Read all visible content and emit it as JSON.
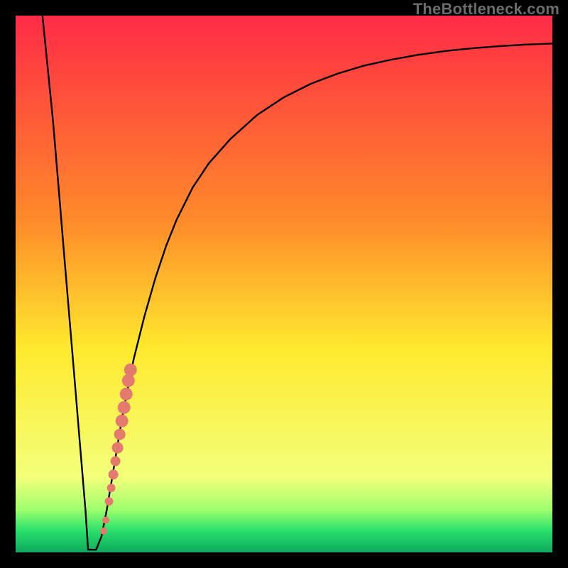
{
  "watermark": "TheBottleneck.com",
  "colors": {
    "frame": "#000000",
    "curve": "#000000",
    "dot": "#e47a6e",
    "grad_top": "#ff2b46",
    "grad_mid1": "#ff8a2a",
    "grad_mid2": "#ffe92e",
    "grad_low": "#f3ff7a",
    "grad_green1": "#9fff6e",
    "grad_green2": "#28e06b",
    "grad_bottom": "#0fa85c"
  },
  "chart_data": {
    "type": "line",
    "title": "",
    "xlabel": "",
    "ylabel": "",
    "xlim": [
      0,
      100
    ],
    "ylim": [
      0,
      100
    ],
    "series": [
      {
        "name": "bottleneck-curve",
        "x": [
          5,
          6,
          7,
          8,
          9,
          10,
          11,
          12,
          13,
          13.5,
          14,
          15,
          16,
          17,
          18,
          19,
          20,
          22,
          24,
          26,
          28,
          30,
          33,
          36,
          40,
          45,
          50,
          55,
          60,
          65,
          70,
          75,
          80,
          85,
          90,
          95,
          100
        ],
        "y": [
          100,
          90,
          80,
          68,
          56,
          44,
          32,
          20,
          8,
          0.5,
          0.5,
          0.5,
          3,
          8,
          14,
          20,
          26,
          36,
          44,
          51,
          57,
          62,
          68,
          72.5,
          77,
          81.5,
          84.8,
          87.3,
          89.2,
          90.7,
          91.8,
          92.7,
          93.4,
          93.9,
          94.3,
          94.6,
          94.8
        ]
      }
    ],
    "flat_segment": {
      "x_start": 13.2,
      "x_end": 15.2,
      "y": 0.5
    },
    "dots": {
      "name": "highlight-points",
      "points": [
        {
          "x": 16.4,
          "y": 4.0,
          "r": 5
        },
        {
          "x": 16.8,
          "y": 6.0,
          "r": 5
        },
        {
          "x": 17.4,
          "y": 9.5,
          "r": 6
        },
        {
          "x": 17.8,
          "y": 12.0,
          "r": 6
        },
        {
          "x": 18.2,
          "y": 14.5,
          "r": 7
        },
        {
          "x": 18.6,
          "y": 17.0,
          "r": 7
        },
        {
          "x": 19.0,
          "y": 19.5,
          "r": 8
        },
        {
          "x": 19.4,
          "y": 22.0,
          "r": 8
        },
        {
          "x": 19.8,
          "y": 24.5,
          "r": 9
        },
        {
          "x": 20.2,
          "y": 27.0,
          "r": 9
        },
        {
          "x": 20.6,
          "y": 29.5,
          "r": 9
        },
        {
          "x": 21.0,
          "y": 32.0,
          "r": 9
        },
        {
          "x": 21.4,
          "y": 34.0,
          "r": 9
        }
      ]
    }
  }
}
